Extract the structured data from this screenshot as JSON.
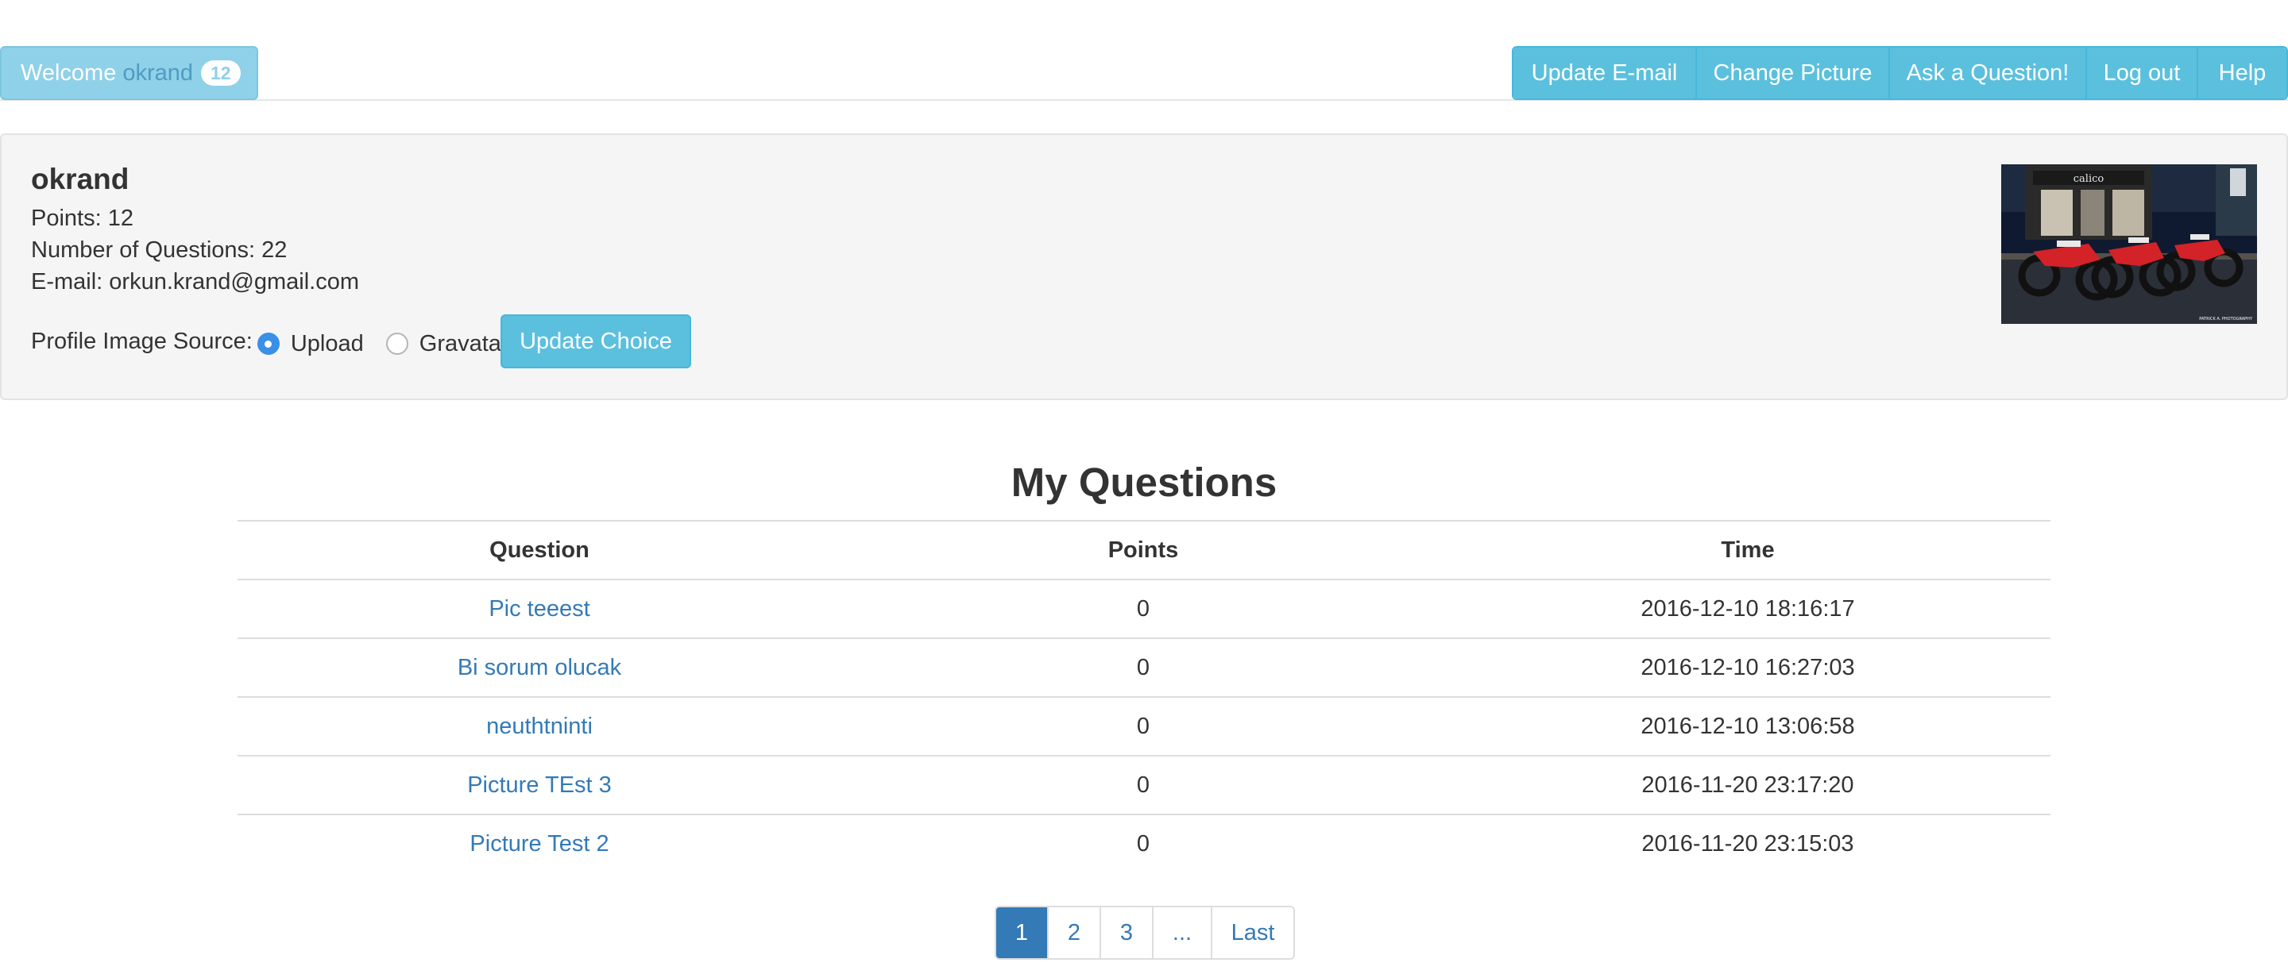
{
  "navbar": {
    "welcome_label": "Welcome",
    "username": "okrand",
    "points_badge": "12",
    "buttons": [
      "Update E-mail",
      "Change Picture",
      "Ask a Question!",
      "Log out",
      "Help"
    ]
  },
  "profile": {
    "name": "okrand",
    "points": "Points: 12",
    "num_questions": "Number of Questions: 22",
    "email": "E-mail: orkun.krand@gmail.com",
    "image_source_label": "Profile Image Source:",
    "options": [
      {
        "label": "Upload",
        "checked": true
      },
      {
        "label": "Gravatar",
        "checked": false
      }
    ],
    "update_choice_label": "Update Choice",
    "photo_sign": "calico",
    "photo_credit": "PATRICK A. PHOTOGRAPHY"
  },
  "questions": {
    "title": "My Questions",
    "headers": [
      "Question",
      "Points",
      "Time"
    ],
    "rows": [
      {
        "question": "Pic teeest",
        "points": "0",
        "time": "2016-12-10 18:16:17"
      },
      {
        "question": "Bi sorum olucak",
        "points": "0",
        "time": "2016-12-10 16:27:03"
      },
      {
        "question": "neuthtninti",
        "points": "0",
        "time": "2016-12-10 13:06:58"
      },
      {
        "question": "Picture TEst 3",
        "points": "0",
        "time": "2016-11-20 23:17:20"
      },
      {
        "question": "Picture Test 2",
        "points": "0",
        "time": "2016-11-20 23:15:03"
      }
    ]
  },
  "pagination": {
    "pages": [
      "1",
      "2",
      "3",
      "...",
      "Last"
    ],
    "active": "1"
  },
  "colors": {
    "info": "#5bc0de",
    "link": "#337ab7",
    "well": "#f5f5f5"
  }
}
